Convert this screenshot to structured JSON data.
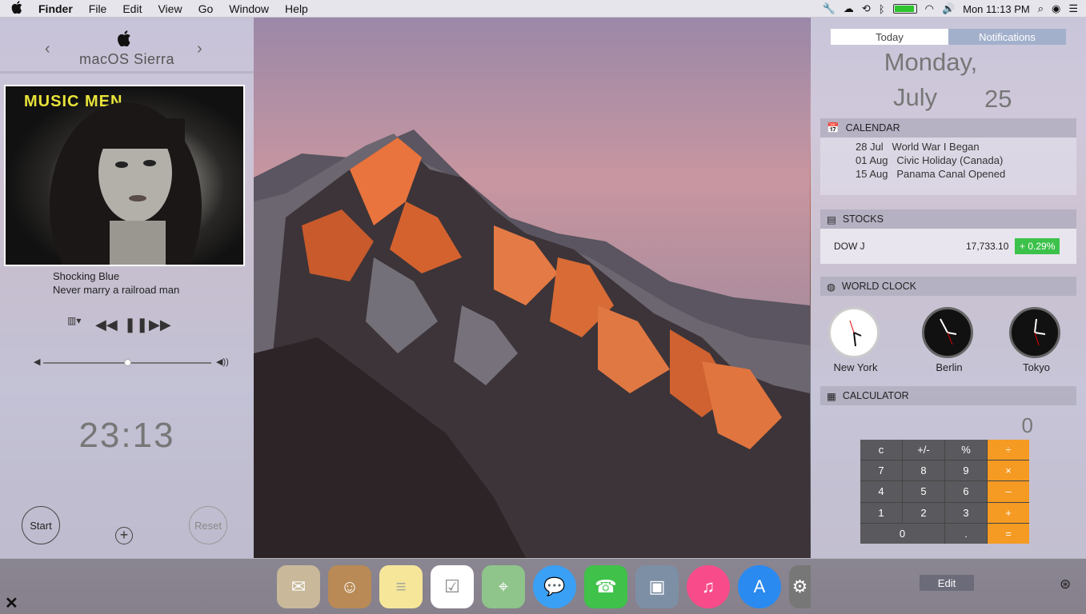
{
  "menubar": {
    "apple": "apple-logo",
    "app": "Finder",
    "items": [
      "File",
      "Edit",
      "View",
      "Go",
      "Window",
      "Help"
    ],
    "clock": "Mon 11:13 PM",
    "battery": 0.95
  },
  "music": {
    "title": "macOS Sierra",
    "prev": "‹",
    "next": "›",
    "album_text": "MUSIC MEN",
    "artist": "Shocking Blue",
    "song": "Never marry a railroad man",
    "volume": 0.5
  },
  "timer": {
    "time": "23:13",
    "start": "Start",
    "reset": "Reset",
    "add": "+"
  },
  "today": {
    "tab_today": "Today",
    "tab_notifications": "Notifications",
    "day": "Monday,",
    "month": "July",
    "date": "25"
  },
  "calendar": {
    "header": "CALENDAR",
    "events": [
      {
        "date": "28 Jul",
        "title": "World War I Began"
      },
      {
        "date": "01 Aug",
        "title": "Civic Holiday (Canada)"
      },
      {
        "date": "15 Aug",
        "title": "Panama Canal Opened"
      }
    ]
  },
  "stocks": {
    "header": "STOCKS",
    "symbol": "DOW J",
    "price": "17,733.10",
    "change": "+ 0.29%"
  },
  "worldclock": {
    "header": "WORLD CLOCK",
    "cities": [
      {
        "name": "New York"
      },
      {
        "name": "Berlin"
      },
      {
        "name": "Tokyo"
      }
    ]
  },
  "calculator": {
    "header": "CALCULATOR",
    "display": "0",
    "keys": [
      "c",
      "+/-",
      "%",
      "÷",
      "7",
      "8",
      "9",
      "×",
      "4",
      "5",
      "6",
      "–",
      "1",
      "2",
      "3",
      "+",
      "0",
      ".",
      "="
    ]
  },
  "edit": "Edit",
  "dock": {
    "icons": [
      "mail-icon",
      "contacts-icon",
      "notes-icon",
      "reminders-icon",
      "maps-icon",
      "messages-icon",
      "facetime-icon",
      "photo-viewer-icon",
      "itunes-icon",
      "app-store-icon",
      "system-preferences-icon"
    ]
  }
}
